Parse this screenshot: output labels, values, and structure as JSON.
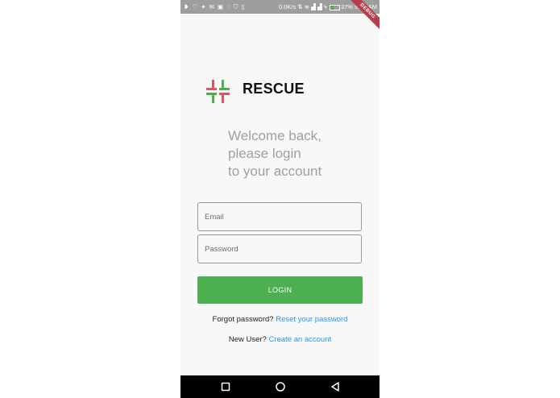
{
  "status_bar": {
    "network_speed": "0.0K/s",
    "battery_percent": "37%",
    "time": "9:35 AM",
    "battery_level": 0.37,
    "icons": [
      "app-icon",
      "shield-icon",
      "twitter-icon",
      "mail-icon",
      "image-icon",
      "circle-icon",
      "vpn-icon",
      "phone-icon",
      "sync-icon",
      "wifi-icon",
      "signal-icon",
      "signal-icon",
      "charging-icon",
      "battery-icon"
    ]
  },
  "debug_banner": "DEBUG",
  "brand": {
    "name": "RESCUE",
    "colors": {
      "red": "#e05563",
      "green": "#4caf50"
    }
  },
  "welcome": {
    "line1": "Welcome back,",
    "line2": "please login",
    "line3": "to your account"
  },
  "form": {
    "email_placeholder": "Email",
    "password_placeholder": "Password",
    "login_label": "LOGIN"
  },
  "links": {
    "forgot_text": "Forgot password?",
    "reset_link": "Reset your password",
    "new_user_text": "New User?",
    "create_link": "Create an account"
  },
  "colors": {
    "accent": "#4caf50",
    "link": "#2196f3",
    "status_bar": "#9e9e9e"
  },
  "nav_bar": {
    "icons": [
      "recent-apps-icon",
      "home-icon",
      "back-icon"
    ]
  }
}
